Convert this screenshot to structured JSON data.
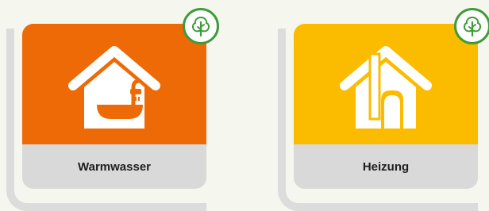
{
  "tiles": [
    {
      "label": "Warmwasser",
      "color": "#ee6a06",
      "icon": "house-shower-icon",
      "badge_icon": "tree-icon"
    },
    {
      "label": "Heizung",
      "color": "#fbbc00",
      "icon": "house-chimney-icon",
      "badge_icon": "tree-icon"
    }
  ],
  "colors": {
    "background": "#f5f6ee",
    "label_bar": "#d9d9d9",
    "frame": "#dcdcdc",
    "eco_green": "#3e9b3a"
  }
}
